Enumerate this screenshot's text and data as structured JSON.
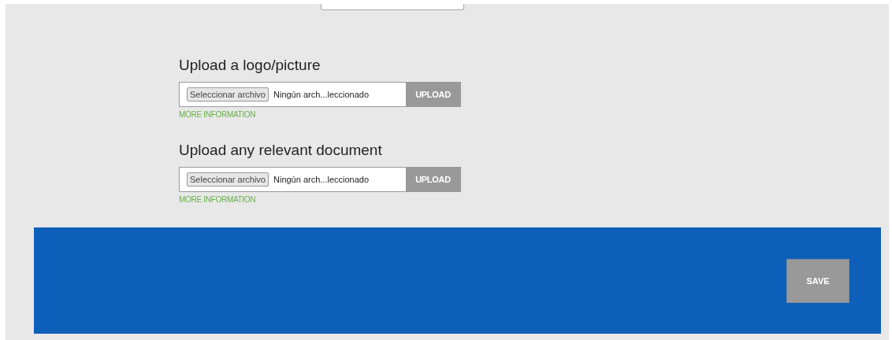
{
  "uploads": [
    {
      "title": "Upload a logo/picture",
      "choose_button": "Seleccionar archivo",
      "file_status": "Ningún arch...leccionado",
      "upload_button": "UPLOAD",
      "more_info": "MORE INFORMATION"
    },
    {
      "title": "Upload any relevant document",
      "choose_button": "Seleccionar archivo",
      "file_status": "Ningún arch...leccionado",
      "upload_button": "UPLOAD",
      "more_info": "MORE INFORMATION"
    }
  ],
  "footer": {
    "save_button": "SAVE"
  }
}
